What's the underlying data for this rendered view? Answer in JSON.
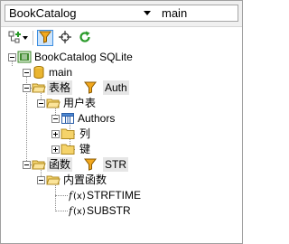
{
  "database_selector": {
    "value": "BookCatalog"
  },
  "schema_selector": {
    "value": "main"
  },
  "toolbar": {
    "buttons": [
      "add-object",
      "filter",
      "locate",
      "refresh"
    ]
  },
  "tree": {
    "database": {
      "name": "BookCatalog",
      "type": "SQLite"
    },
    "schema": {
      "name": "main"
    },
    "tables_folder": {
      "label": "表格",
      "filter": "Auth"
    },
    "user_tables_folder": {
      "label": "用户表"
    },
    "table": {
      "name": "Authors"
    },
    "columns_folder": {
      "label": "列"
    },
    "keys_folder": {
      "label": "键"
    },
    "functions_folder": {
      "label": "函数",
      "filter": "STR"
    },
    "builtin_functions_folder": {
      "label": "内置函数"
    },
    "functions": [
      "STRFTIME",
      "SUBSTR"
    ]
  },
  "colors": {
    "folder": "#f0c850",
    "filter_funnel": "#e8a010",
    "refresh": "#2a9a2a",
    "db_icon": "#e0a020"
  }
}
